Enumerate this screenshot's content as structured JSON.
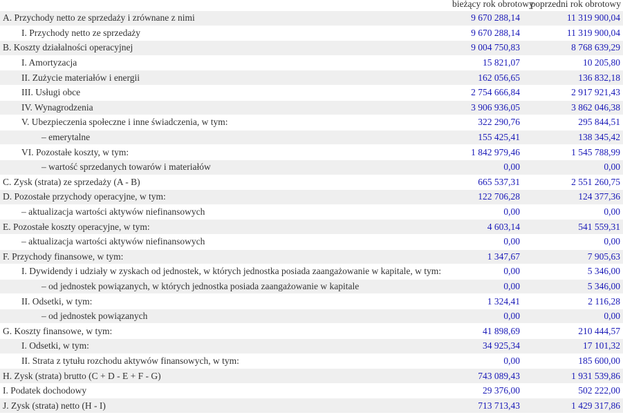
{
  "header": {
    "current_year": "bieżący rok obrotowy",
    "previous_year": "poprzedni rok obrotowy"
  },
  "rows": [
    {
      "label": "A. Przychody netto ze sprzedaży i zrównane z nimi",
      "level": 0,
      "current": "9 670 288,14",
      "previous": "11 319 900,04"
    },
    {
      "label": "I. Przychody netto ze sprzedaży",
      "level": 1,
      "current": "9 670 288,14",
      "previous": "11 319 900,04"
    },
    {
      "label": "B. Koszty działalności operacyjnej",
      "level": 0,
      "current": "9 004 750,83",
      "previous": "8 768 639,29"
    },
    {
      "label": "I. Amortyzacja",
      "level": 1,
      "current": "15 821,07",
      "previous": "10 205,80"
    },
    {
      "label": "II. Zużycie materiałów i energii",
      "level": 1,
      "current": "162 056,65",
      "previous": "136 832,18"
    },
    {
      "label": "III. Usługi obce",
      "level": 1,
      "current": "2 754 666,84",
      "previous": "2 917 921,43"
    },
    {
      "label": "IV. Wynagrodzenia",
      "level": 1,
      "current": "3 906 936,05",
      "previous": "3 862 046,38"
    },
    {
      "label": "V. Ubezpieczenia społeczne i inne świadczenia, w tym:",
      "level": 1,
      "current": "322 290,76",
      "previous": "295 844,51"
    },
    {
      "label": "– emerytalne",
      "level": 2,
      "current": "155 425,41",
      "previous": "138 345,42"
    },
    {
      "label": "VI. Pozostałe koszty, w tym:",
      "level": 1,
      "current": "1 842 979,46",
      "previous": "1 545 788,99"
    },
    {
      "label": "– wartość sprzedanych towarów i materiałów",
      "level": 2,
      "current": "0,00",
      "previous": "0,00"
    },
    {
      "label": "C. Zysk (strata) ze sprzedaży (A - B)",
      "level": 0,
      "current": "665 537,31",
      "previous": "2 551 260,75"
    },
    {
      "label": "D. Pozostałe przychody operacyjne, w tym:",
      "level": 0,
      "current": "122 706,28",
      "previous": "124 377,36"
    },
    {
      "label": "– aktualizacja wartości aktywów niefinansowych",
      "level": 1,
      "current": "0,00",
      "previous": "0,00"
    },
    {
      "label": "E. Pozostałe koszty operacyjne, w tym:",
      "level": 0,
      "current": "4 603,14",
      "previous": "541 559,31"
    },
    {
      "label": "– aktualizacja wartości aktywów niefinansowych",
      "level": 1,
      "current": "0,00",
      "previous": "0,00"
    },
    {
      "label": "F. Przychody finansowe, w tym:",
      "level": 0,
      "current": "1 347,67",
      "previous": "7 905,63"
    },
    {
      "label": "I. Dywidendy i udziały w zyskach od jednostek, w których jednostka posiada zaangażowanie w kapitale, w tym:",
      "level": 1,
      "current": "0,00",
      "previous": "5 346,00"
    },
    {
      "label": "– od jednostek powiązanych, w których jednostka posiada zaangażowanie w kapitale",
      "level": 2,
      "current": "0,00",
      "previous": "5 346,00"
    },
    {
      "label": "II. Odsetki, w tym:",
      "level": 1,
      "current": "1 324,41",
      "previous": "2 116,28"
    },
    {
      "label": "– od jednostek powiązanych",
      "level": 2,
      "current": "0,00",
      "previous": "0,00"
    },
    {
      "label": "G. Koszty finansowe, w tym:",
      "level": 0,
      "current": "41 898,69",
      "previous": "210 444,57"
    },
    {
      "label": "I. Odsetki, w tym:",
      "level": 1,
      "current": "34 925,34",
      "previous": "17 101,32"
    },
    {
      "label": "II. Strata z tytułu rozchodu aktywów finansowych, w tym:",
      "level": 1,
      "current": "0,00",
      "previous": "185 600,00"
    },
    {
      "label": "H. Zysk (strata) brutto (C + D - E + F - G)",
      "level": 0,
      "current": "743 089,43",
      "previous": "1 931 539,86"
    },
    {
      "label": "I. Podatek dochodowy",
      "level": 0,
      "current": "29 376,00",
      "previous": "502 222,00"
    },
    {
      "label": "J. Zysk (strata) netto (H - I)",
      "level": 0,
      "current": "713 713,43",
      "previous": "1 429 317,86"
    }
  ]
}
